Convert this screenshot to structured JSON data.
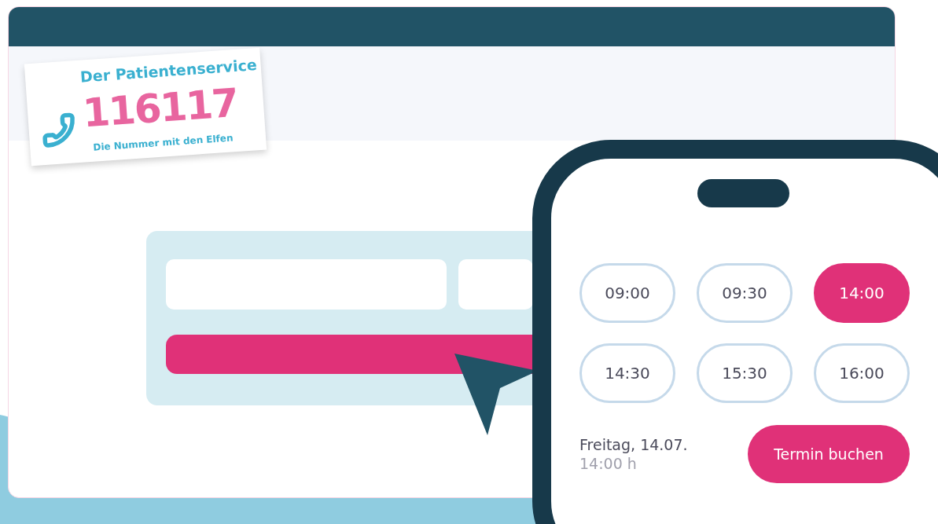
{
  "logo": {
    "tagline": "Der Patientenservice",
    "number": "116117",
    "slogan": "Die Nummer mit den Elfen"
  },
  "phone": {
    "slots": [
      {
        "time": "09:00",
        "selected": false
      },
      {
        "time": "09:30",
        "selected": false
      },
      {
        "time": "14:00",
        "selected": true
      },
      {
        "time": "14:30",
        "selected": false
      },
      {
        "time": "15:30",
        "selected": false
      },
      {
        "time": "16:00",
        "selected": false
      }
    ],
    "summary": {
      "date": "Freitag, 14.07.",
      "time": "14:00 h"
    },
    "book_button": "Termin buchen"
  }
}
